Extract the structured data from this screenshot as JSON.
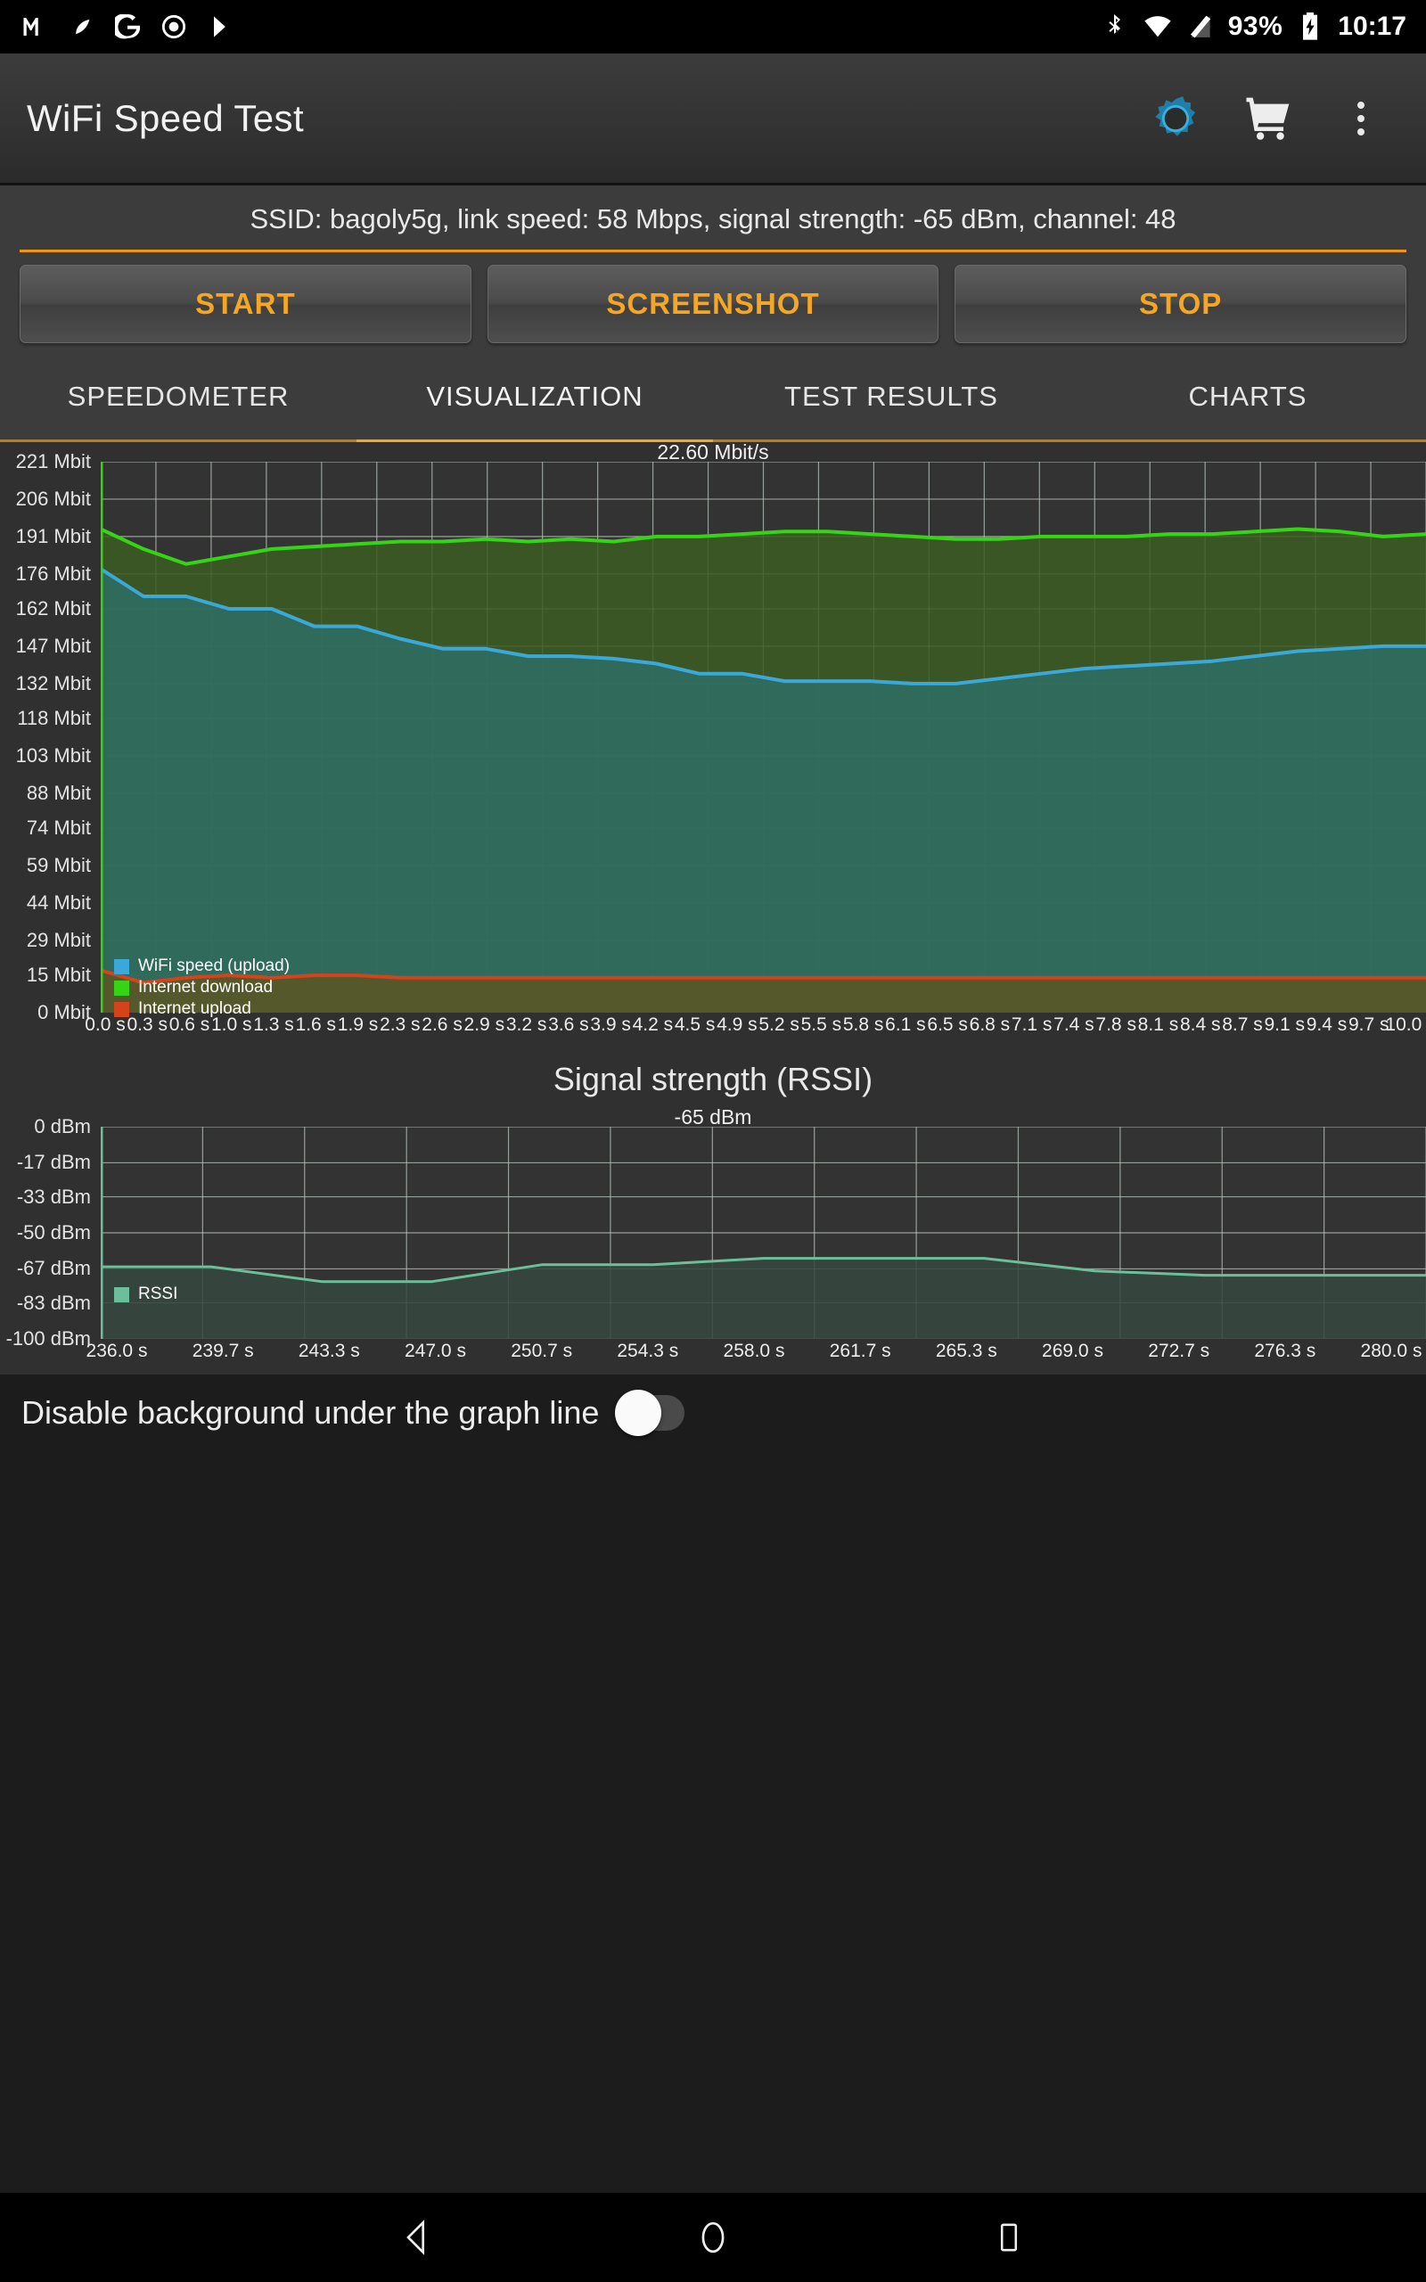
{
  "status_bar": {
    "left_icons": [
      "gmail-icon",
      "drop-icon",
      "google-icon",
      "record-icon",
      "play-icon"
    ],
    "bluetooth_icon": "bluetooth-icon",
    "wifi_icon": "wifi-icon",
    "signal_off_icon": "signal-off-icon",
    "battery_percent": "93%",
    "battery_icon": "battery-charging-icon",
    "time": "10:17"
  },
  "app_bar": {
    "title": "WiFi Speed Test",
    "settings_icon": "gear-icon",
    "cart_icon": "shopping-cart-icon",
    "overflow_icon": "overflow-menu-icon"
  },
  "info": {
    "line": "SSID: bagoly5g, link speed: 58 Mbps, signal strength: -65 dBm, channel: 48",
    "accent_color": "#f5a623"
  },
  "buttons": {
    "start": "START",
    "screenshot": "SCREENSHOT",
    "stop": "STOP"
  },
  "tabs": {
    "items": [
      "SPEEDOMETER",
      "VISUALIZATION",
      "TEST RESULTS",
      "CHARTS"
    ],
    "active_index": 1
  },
  "footer": {
    "toggle_label": "Disable background under the graph line",
    "toggle_state": "off"
  },
  "nav_bar": {
    "back_icon": "back-triangle-icon",
    "home_icon": "home-circle-icon",
    "recents_icon": "recents-square-icon"
  },
  "chart_data": [
    {
      "type": "area",
      "id": "speed-chart",
      "title": "22.60 Mbit/s",
      "xlabel": "",
      "ylabel": "",
      "grid": true,
      "legend_position": "inside-bottom-left",
      "ylim": [
        0,
        221
      ],
      "ytick_labels": [
        "221 Mbit",
        "206 Mbit",
        "191 Mbit",
        "176 Mbit",
        "162 Mbit",
        "147 Mbit",
        "132 Mbit",
        "118 Mbit",
        "103 Mbit",
        "88 Mbit",
        "74 Mbit",
        "59 Mbit",
        "44 Mbit",
        "29 Mbit",
        "15 Mbit",
        "0 Mbit"
      ],
      "ytick_values": [
        221,
        206,
        191,
        176,
        162,
        147,
        132,
        118,
        103,
        88,
        74,
        59,
        44,
        29,
        15,
        0
      ],
      "xtick_labels": [
        "0.0 s",
        "0.3 s",
        "0.6 s",
        "1.0 s",
        "1.3 s",
        "1.6 s",
        "1.9 s",
        "2.3 s",
        "2.6 s",
        "2.9 s",
        "3.2 s",
        "3.6 s",
        "3.9 s",
        "4.2 s",
        "4.5 s",
        "4.9 s",
        "5.2 s",
        "5.5 s",
        "5.8 s",
        "6.1 s",
        "6.5 s",
        "6.8 s",
        "7.1 s",
        "7.4 s",
        "7.8 s",
        "8.1 s",
        "8.4 s",
        "8.7 s",
        "9.1 s",
        "9.4 s",
        "9.7 s",
        "10.0 s"
      ],
      "x": [
        0.0,
        0.3,
        0.6,
        1.0,
        1.3,
        1.6,
        1.9,
        2.3,
        2.6,
        2.9,
        3.2,
        3.6,
        3.9,
        4.2,
        4.5,
        4.9,
        5.2,
        5.5,
        5.8,
        6.1,
        6.5,
        6.8,
        7.1,
        7.4,
        7.8,
        8.1,
        8.4,
        8.7,
        9.1,
        9.4,
        9.7,
        10.0
      ],
      "series": [
        {
          "name": "Internet download",
          "color": "#35d513",
          "fill": "#3d5c23",
          "values": [
            194,
            186,
            180,
            183,
            186,
            187,
            188,
            189,
            189,
            190,
            189,
            190,
            189,
            191,
            191,
            192,
            193,
            193,
            192,
            191,
            190,
            190,
            191,
            191,
            191,
            192,
            192,
            193,
            194,
            193,
            191,
            192
          ]
        },
        {
          "name": "WiFi speed (upload)",
          "color": "#3aa8d8",
          "fill": "#2f6e64",
          "values": [
            178,
            167,
            167,
            162,
            162,
            155,
            155,
            150,
            146,
            146,
            143,
            143,
            142,
            140,
            136,
            136,
            133,
            133,
            133,
            132,
            132,
            134,
            136,
            138,
            139,
            140,
            141,
            143,
            145,
            146,
            147,
            147
          ]
        },
        {
          "name": "Internet upload",
          "color": "#d6421a",
          "fill": "#5b5523",
          "values": [
            17,
            12,
            14,
            15,
            14,
            15,
            15,
            14,
            14,
            14,
            14,
            14,
            14,
            14,
            14,
            14,
            14,
            14,
            14,
            14,
            14,
            14,
            14,
            14,
            14,
            14,
            14,
            14,
            14,
            14,
            14,
            14
          ]
        }
      ]
    },
    {
      "type": "area",
      "id": "rssi-chart",
      "title": "Signal strength (RSSI)",
      "caption": "-65 dBm",
      "xlabel": "",
      "ylabel": "",
      "grid": true,
      "legend_position": "inside-bottom-left",
      "ylim": [
        -100,
        0
      ],
      "ytick_labels": [
        "0 dBm",
        "-17 dBm",
        "-33 dBm",
        "-50 dBm",
        "-67 dBm",
        "-83 dBm",
        "-100 dBm"
      ],
      "ytick_values": [
        0,
        -17,
        -33,
        -50,
        -67,
        -83,
        -100
      ],
      "xtick_labels": [
        "236.0 s",
        "239.7 s",
        "243.3 s",
        "247.0 s",
        "250.7 s",
        "254.3 s",
        "258.0 s",
        "261.7 s",
        "265.3 s",
        "269.0 s",
        "272.7 s",
        "276.3 s",
        "280.0 s"
      ],
      "x": [
        236.0,
        239.7,
        243.3,
        247.0,
        250.7,
        254.3,
        258.0,
        261.7,
        265.3,
        269.0,
        272.7,
        276.3,
        280.0
      ],
      "series": [
        {
          "name": "RSSI",
          "color": "#6bbf9a",
          "fill": "#36473f",
          "values": [
            -66,
            -66,
            -73,
            -73,
            -65,
            -65,
            -62,
            -62,
            -62,
            -68,
            -70,
            -70,
            -70,
            -70,
            -62,
            -62,
            -70,
            -70,
            -76,
            -76,
            -69,
            -69,
            -66,
            -65,
            -65,
            -65,
            -69,
            -69
          ]
        }
      ]
    }
  ]
}
